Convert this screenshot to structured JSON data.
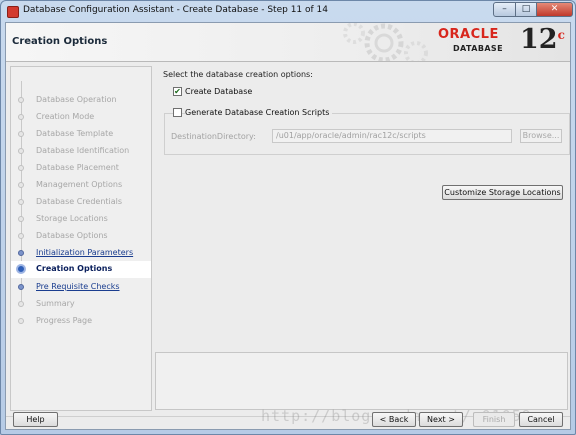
{
  "window": {
    "title": "Database Configuration Assistant - Create Database - Step 11 of 14"
  },
  "banner": {
    "heading": "Creation Options",
    "brand": "ORACLE",
    "sub": "DATABASE",
    "version": "12",
    "version_suffix": "c"
  },
  "steps": [
    {
      "label": "Database Operation",
      "state": "disabled"
    },
    {
      "label": "Creation Mode",
      "state": "disabled"
    },
    {
      "label": "Database Template",
      "state": "disabled"
    },
    {
      "label": "Database Identification",
      "state": "disabled"
    },
    {
      "label": "Database Placement",
      "state": "disabled"
    },
    {
      "label": "Management Options",
      "state": "disabled"
    },
    {
      "label": "Database Credentials",
      "state": "disabled"
    },
    {
      "label": "Storage Locations",
      "state": "disabled"
    },
    {
      "label": "Database Options",
      "state": "disabled"
    },
    {
      "label": "Initialization Parameters",
      "state": "link"
    },
    {
      "label": "Creation Options",
      "state": "current"
    },
    {
      "label": "Pre Requisite Checks",
      "state": "link"
    },
    {
      "label": "Summary",
      "state": "disabled"
    },
    {
      "label": "Progress Page",
      "state": "disabled"
    }
  ],
  "main": {
    "prompt": "Select the database creation options:",
    "create_db": {
      "label": "Create Database",
      "checked": true
    },
    "gen_scripts": {
      "label": "Generate Database Creation Scripts",
      "checked": false
    },
    "dest_label": "DestinationDirectory:",
    "dest_value": "/u01/app/oracle/admin/rac12c/scripts",
    "browse": "Browse...",
    "customize": "Customize Storage Locations"
  },
  "footer": {
    "help": "Help",
    "back": "< Back",
    "next": "Next >",
    "finish": "Finish",
    "cancel": "Cancel"
  },
  "watermark": "http://blog.csdn.net/u01059"
}
